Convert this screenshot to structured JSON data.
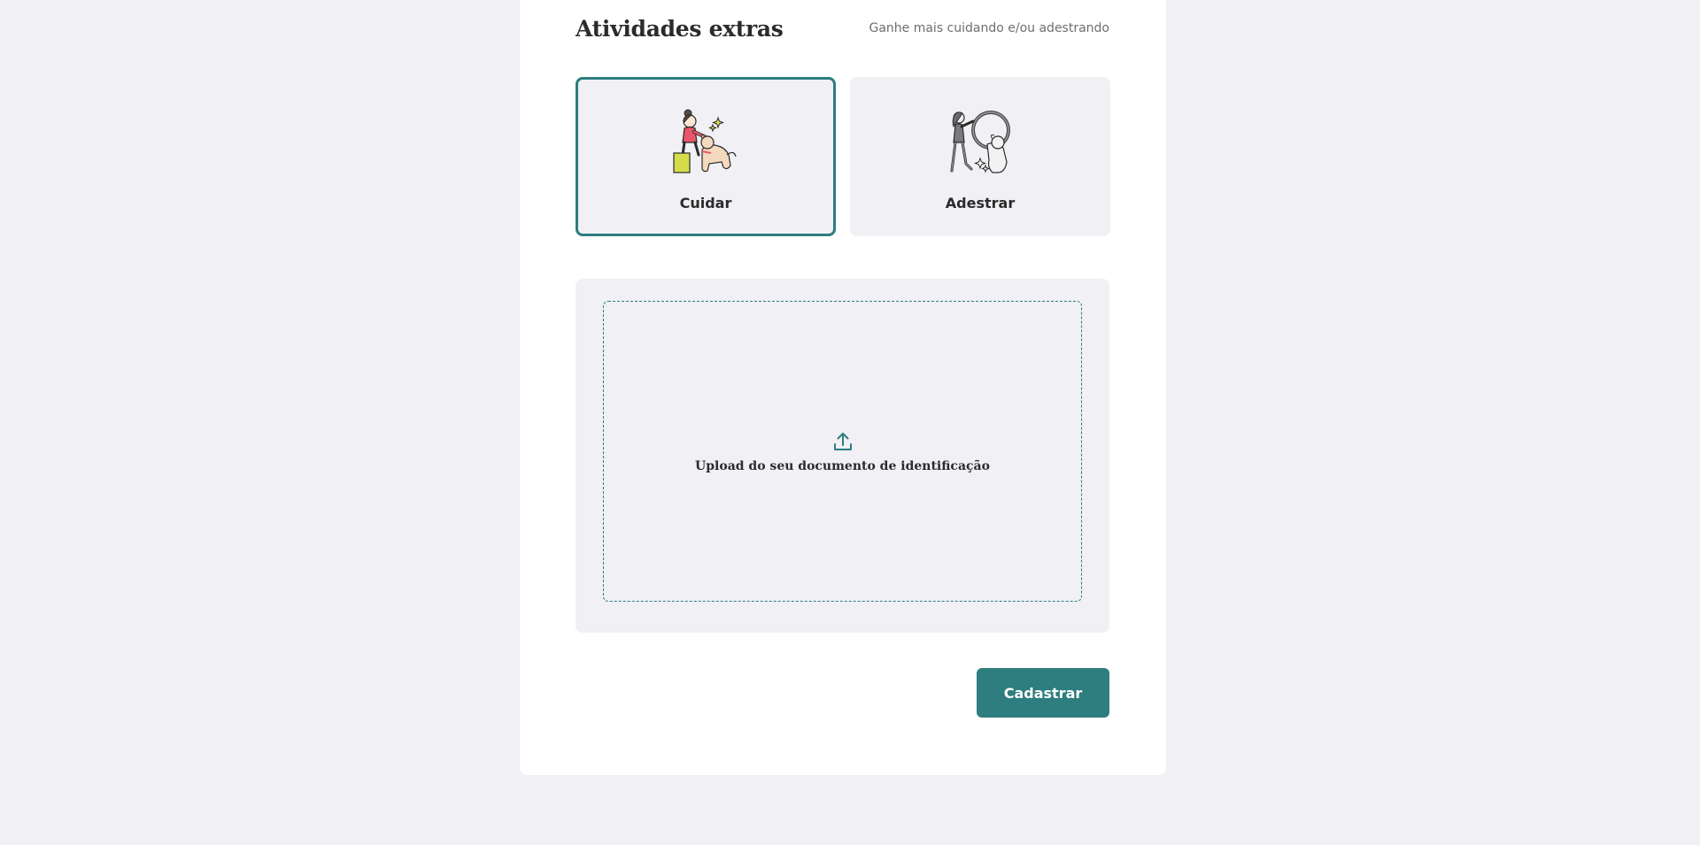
{
  "section": {
    "title": "Atividades extras",
    "subtitle": "Ganhe mais cuidando e/ou adestrando"
  },
  "activities": [
    {
      "label": "Cuidar",
      "icon": "pet-care-illustration",
      "selected": true
    },
    {
      "label": "Adestrar",
      "icon": "pet-training-illustration",
      "selected": false
    }
  ],
  "upload": {
    "label": "Upload do seu documento de identificação",
    "icon": "upload-icon"
  },
  "submit": {
    "label": "Cadastrar"
  },
  "colors": {
    "accent": "#2E7D7F",
    "background": "#F0F0F5",
    "card": "#FFFFFF",
    "text": "#2B2B2B",
    "muted_text": "#6E6E73",
    "illustration_pink": "#E8566A",
    "illustration_yellow": "#D4DC4A",
    "illustration_dog": "#F3D9BE"
  }
}
